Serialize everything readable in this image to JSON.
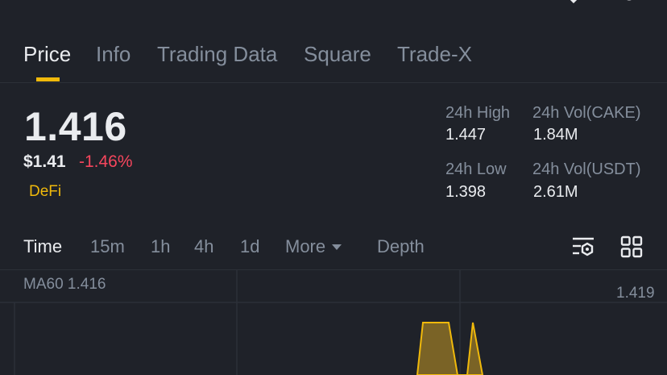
{
  "tabs": [
    {
      "label": "Price",
      "active": true
    },
    {
      "label": "Info"
    },
    {
      "label": "Trading Data"
    },
    {
      "label": "Square"
    },
    {
      "label": "Trade-X"
    }
  ],
  "ticker": {
    "last_price": "1.416",
    "usd_price": "$1.41",
    "change_pct": "-1.46%",
    "category_tag": "DeFi"
  },
  "stats": {
    "high_label": "24h High",
    "high_value": "1.447",
    "low_label": "24h Low",
    "low_value": "1.398",
    "vol_base_label": "24h Vol(CAKE)",
    "vol_base_value": "1.84M",
    "vol_quote_label": "24h Vol(USDT)",
    "vol_quote_value": "2.61M"
  },
  "timeframes": {
    "time": "Time",
    "m15": "15m",
    "h1": "1h",
    "h4": "4h",
    "d1": "1d",
    "more": "More",
    "depth": "Depth"
  },
  "chart": {
    "ma_label": "MA60 1.416",
    "y_label": "1.419"
  },
  "colors": {
    "background": "#1f2229",
    "accent": "#f0b90b",
    "negative": "#f6465d",
    "muted_text": "#848e9c",
    "primary_text": "#eaecef"
  },
  "icons": {
    "chart_settings": "chart-settings-icon",
    "grid": "grid-icon"
  }
}
